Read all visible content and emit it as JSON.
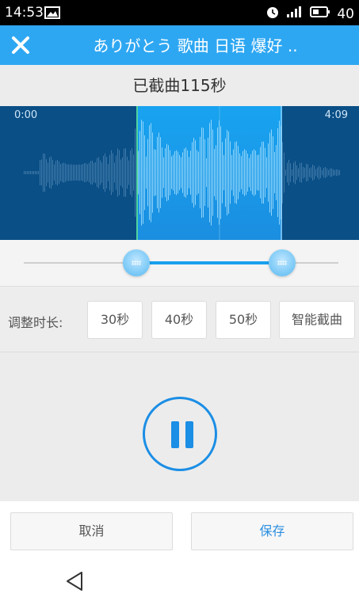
{
  "status": {
    "time": "14:53",
    "battery": "40"
  },
  "header": {
    "title": "ありがとう 歌曲 日语 爆好 .."
  },
  "cut_info": "已截曲115秒",
  "wave": {
    "start_time": "0:00",
    "end_time": "4:09"
  },
  "adjust": {
    "label": "调整时长:",
    "options": [
      "30秒",
      "40秒",
      "50秒",
      "智能截曲"
    ]
  },
  "actions": {
    "cancel": "取消",
    "save": "保存"
  },
  "colors": {
    "accent": "#2ea7f2",
    "wave_bg": "#0a4f86",
    "selection": "#18a3f0",
    "save_text": "#2b8fe0"
  }
}
